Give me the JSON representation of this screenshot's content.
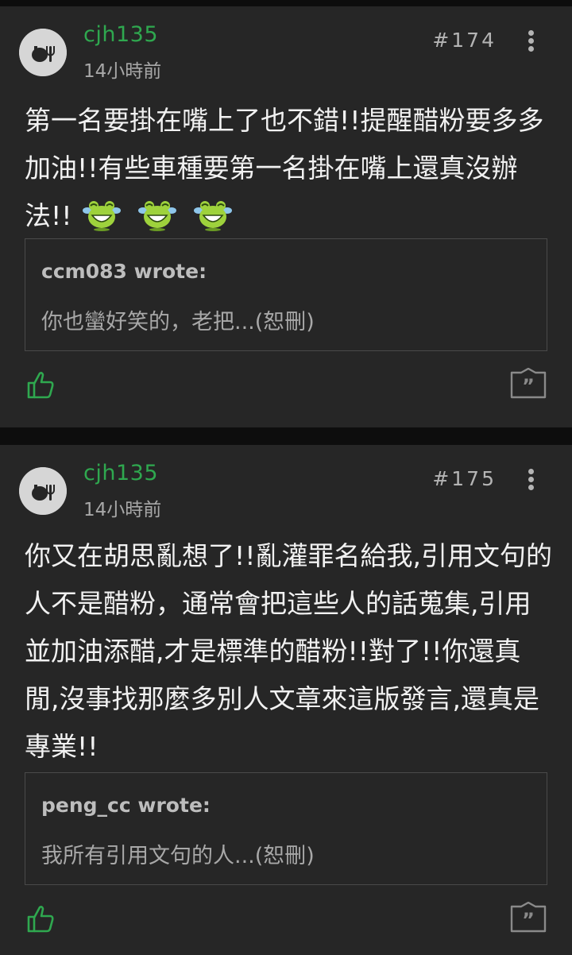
{
  "posts": [
    {
      "username": "cjh135",
      "time": "14小時前",
      "floor": "#174",
      "content_text": "第一名要掛在嘴上了也不錯!!提醒醋粉要多多加油!!有些車種要第一名掛在嘴上還真沒辦法!!",
      "emojis": [
        "laughing-frog-icon",
        "laughing-frog-icon",
        "laughing-frog-icon"
      ],
      "quote": {
        "author": "ccm083 wrote:",
        "text": "你也蠻好笑的，老把...(恕刪)"
      }
    },
    {
      "username": "cjh135",
      "time": "14小時前",
      "floor": "#175",
      "content_text": "你又在胡思亂想了!!亂灌罪名給我,引用文句的人不是醋粉，通常會把這些人的話蒐集,引用並加油添醋,才是標準的醋粉!!對了!!你還真閒,沒事找那麼多別人文章來這版發言,還真是專業!!",
      "quote": {
        "author": "peng_cc wrote:",
        "text": "我所有引用文句的人...(恕刪)"
      }
    }
  ],
  "colors": {
    "background": "#0d0d0d",
    "card": "#262626",
    "username": "#2fa84f",
    "like_icon": "#2fa84f",
    "meta_text": "#a8a8a8",
    "body_text": "#f1f1f1"
  },
  "icons": {
    "avatar": "default-avatar-icon",
    "more": "more-vertical-icon",
    "like": "thumbs-up-icon",
    "reply": "quote-reply-icon"
  }
}
